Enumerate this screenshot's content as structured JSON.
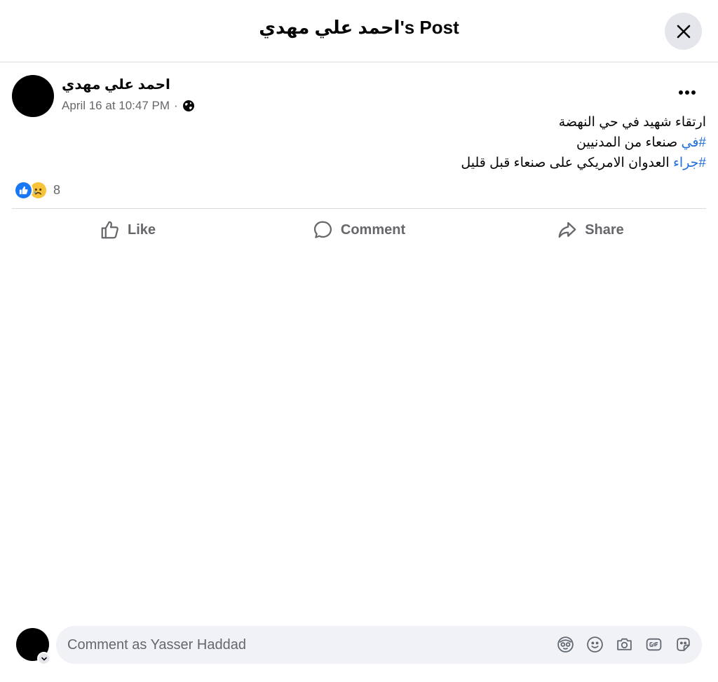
{
  "header": {
    "title": "احمد علي مهدي's Post",
    "close_icon": "close-icon"
  },
  "post": {
    "author": "احمد علي مهدي",
    "timestamp": "April 16 at 10:47 PM",
    "separator": "·",
    "privacy_icon": "globe-icon",
    "more_icon": "more-dots-icon",
    "lines": [
      {
        "hashtag": "",
        "text": "ارتقاء شهيد في حي النهضة"
      },
      {
        "hashtag": "#في",
        "text": " صنعاء من المدنيين"
      },
      {
        "hashtag": "#جراء",
        "text": " العدوان الامريكي على صنعاء قبل قليل"
      }
    ],
    "reactions": {
      "icons": [
        "like-reaction-icon",
        "sad-reaction-icon"
      ],
      "count": "8"
    }
  },
  "actions": {
    "like": "Like",
    "comment": "Comment",
    "share": "Share"
  },
  "composer": {
    "placeholder": "Comment as Yasser Haddad",
    "tools": [
      "avatar-sticker-icon",
      "emoji-icon",
      "camera-icon",
      "gif-icon",
      "sticker-icon"
    ]
  },
  "colors": {
    "hashtag": "#216fdb",
    "like_blue": "#1877f2",
    "secondary_text": "#65676b",
    "input_bg": "#f0f2f5"
  }
}
